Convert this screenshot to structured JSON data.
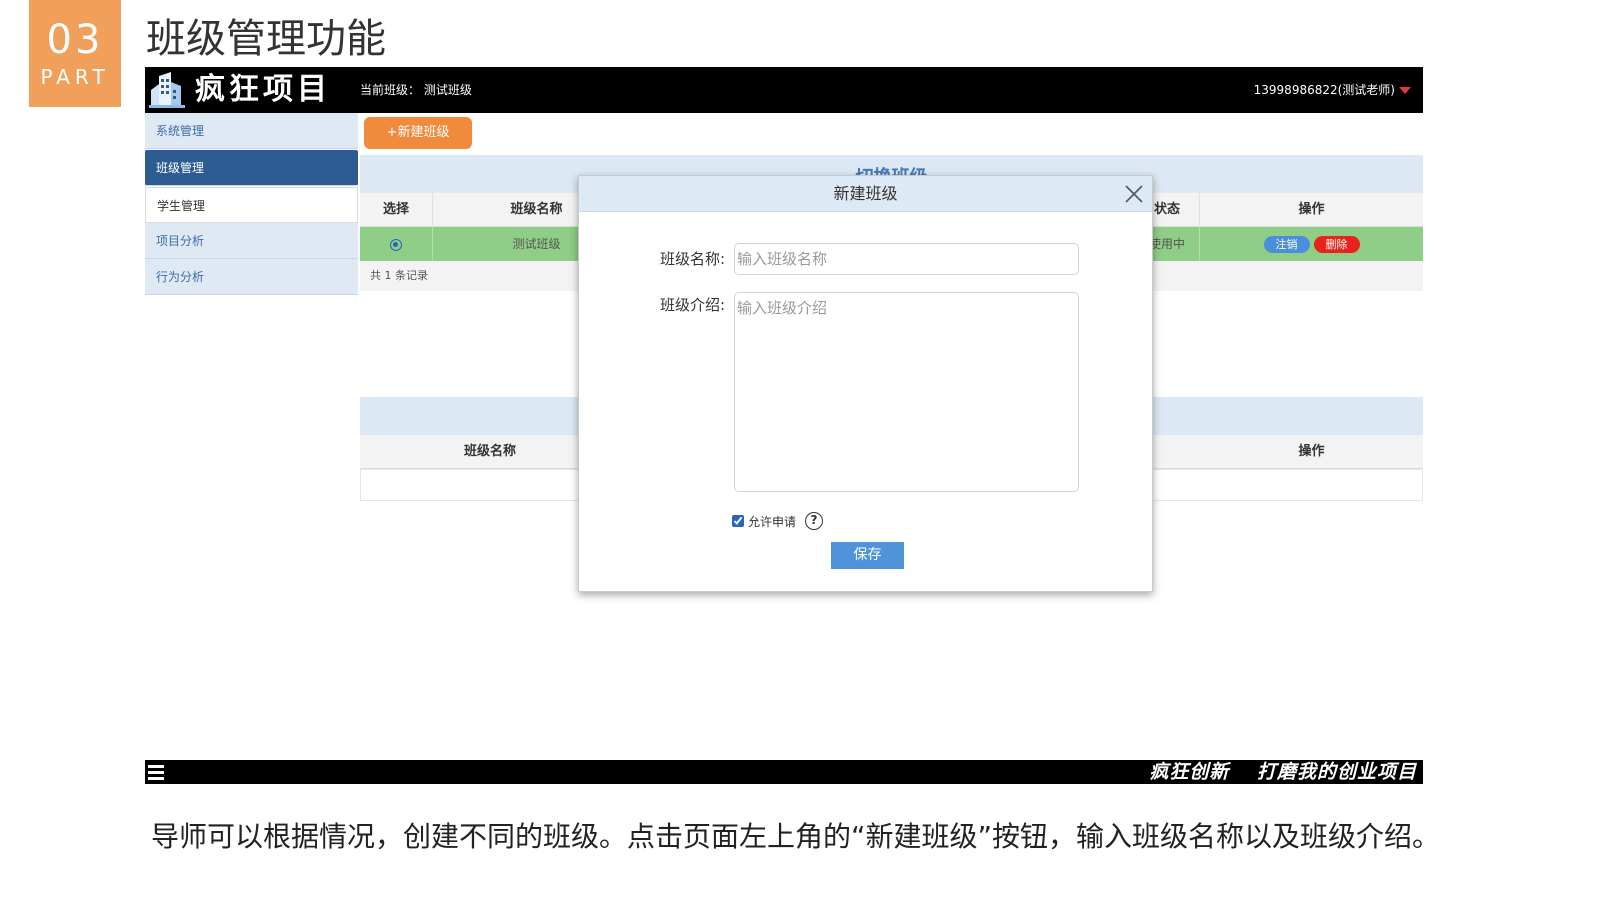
{
  "slide": {
    "part_number": "03",
    "part_word": "PART",
    "title": "班级管理功能",
    "caption": "导师可以根据情况，创建不同的班级。点击页面左上角的“新建班级”按钮，输入班级名称以及班级介绍。"
  },
  "app": {
    "brand": "疯狂项目",
    "current_class": "当前班级：   测试班级",
    "user": "13998986822(测试老师)",
    "sidebar": {
      "items": [
        {
          "label": "系统管理"
        },
        {
          "label": "班级管理"
        },
        {
          "label": "学生管理"
        },
        {
          "label": "项目分析"
        },
        {
          "label": "行为分析"
        }
      ]
    },
    "toolbar": {
      "new_class_label": "+新建班级"
    },
    "switch_panel": {
      "title": "切换班级",
      "columns": {
        "select": "选择",
        "name": "班级名称",
        "status": "状态",
        "actions": "操作"
      },
      "rows": [
        {
          "name": "测试班级",
          "status": "使用中",
          "cancel_label": "注销",
          "delete_label": "删除"
        }
      ],
      "record_count": "共 1 条记录"
    },
    "second_panel": {
      "columns": {
        "name": "班级名称",
        "actions": "操作"
      }
    }
  },
  "modal": {
    "title": "新建班级",
    "name_label": "班级名称:",
    "name_placeholder": "输入班级名称",
    "intro_label": "班级介绍:",
    "intro_placeholder": "输入班级介绍",
    "allow_apply_label": "允许申请",
    "allow_apply_checked": true,
    "help_glyph": "?",
    "save_label": "保存"
  },
  "footer": {
    "slogan": "疯狂创新 打磨我的创业项目"
  },
  "colors": {
    "accent_orange": "#f0a05a",
    "nav_active": "#2d5c93",
    "row_selected": "#8fce86",
    "save_button": "#4f94d8",
    "delete_pill": "#e8231b"
  }
}
